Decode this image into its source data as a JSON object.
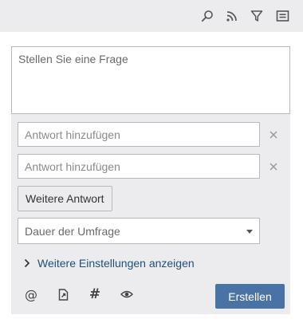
{
  "toolbar": {
    "icons": [
      "search-icon",
      "rss-icon",
      "filter-icon",
      "comment-icon"
    ]
  },
  "question": {
    "placeholder": "Stellen Sie eine Frage"
  },
  "answers": [
    {
      "placeholder": "Antwort hinzufügen"
    },
    {
      "placeholder": "Antwort hinzufügen"
    }
  ],
  "more_answer_label": "Weitere Antwort",
  "duration": {
    "placeholder": "Dauer der Umfrage"
  },
  "settings_link_label": "Weitere Einstellungen anzeigen",
  "bottom_icons": [
    "at-icon",
    "attachment-icon",
    "hashtag-icon",
    "eye-icon"
  ],
  "create_label": "Erstellen",
  "colors": {
    "toolbar_bg": "#ececee",
    "panel_bg": "#ececee",
    "link": "#1f4e79",
    "primary_button": "#4a73a5"
  }
}
